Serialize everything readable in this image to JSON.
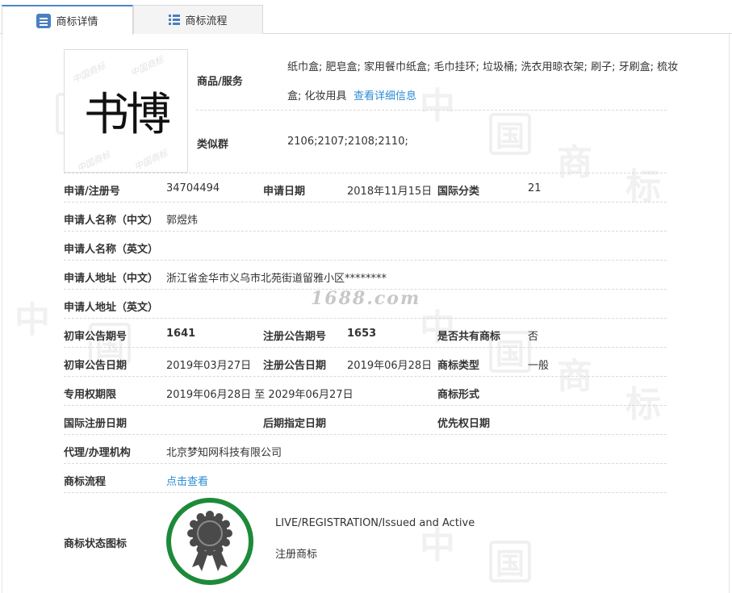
{
  "tabs": [
    {
      "label": "商标详情",
      "icon": "document-icon",
      "active": true
    },
    {
      "label": "商标流程",
      "icon": "list-icon",
      "active": false
    }
  ],
  "logo": {
    "text": "书博"
  },
  "goods": {
    "label": "商品/服务",
    "line1": "纸巾盒; 肥皂盒; 家用餐巾纸盒; 毛巾挂环; 垃圾桶; 洗衣用晾衣架; 刷子; 牙刷盒; 梳妆",
    "line2": "盒; 化妆用具",
    "link": "查看详细信息"
  },
  "similar": {
    "label": "类似群",
    "value": "2106;2107;2108;2110;"
  },
  "fields": {
    "reg_no_label": "申请/注册号",
    "reg_no": "34704494",
    "apply_date_label": "申请日期",
    "apply_date": "2018年11月15日",
    "intl_class_label": "国际分类",
    "intl_class": "21",
    "applicant_cn_label": "申请人名称（中文）",
    "applicant_cn": "郭煜炜",
    "applicant_en_label": "申请人名称（英文）",
    "applicant_en": "",
    "address_cn_label": "申请人地址（中文）",
    "address_cn": "浙江省金华市义乌市北苑街道留雅小区********",
    "address_en_label": "申请人地址（英文）",
    "address_en": "",
    "prelim_no_label": "初审公告期号",
    "prelim_no": "1641",
    "reg_notice_no_label": "注册公告期号",
    "reg_notice_no": "1653",
    "shared_label": "是否共有商标",
    "shared": "否",
    "prelim_date_label": "初审公告日期",
    "prelim_date": "2019年03月27日",
    "reg_notice_date_label": "注册公告日期",
    "reg_notice_date": "2019年06月28日",
    "tm_type_label": "商标类型",
    "tm_type": "一般",
    "exclusive_label": "专用权期限",
    "exclusive": "2019年06月28日 至 2029年06月27日",
    "tm_form_label": "商标形式",
    "tm_form": "",
    "intl_reg_date_label": "国际注册日期",
    "intl_reg_date": "",
    "later_date_label": "后期指定日期",
    "later_date": "",
    "priority_date_label": "优先权日期",
    "priority_date": "",
    "agency_label": "代理/办理机构",
    "agency": "北京梦知网科技有限公司",
    "process_label": "商标流程",
    "process_link": "点击查看",
    "status_icon_label": "商标状态图标",
    "status_en": "LIVE/REGISTRATION/Issued and Active",
    "status_cn": "注册商标"
  },
  "watermark": {
    "site": "1688.com"
  },
  "colors": {
    "accent": "#4a86c8",
    "link": "#2b8cd6",
    "badge_green": "#1d8a3a",
    "badge_gray": "#4a4a4a"
  }
}
